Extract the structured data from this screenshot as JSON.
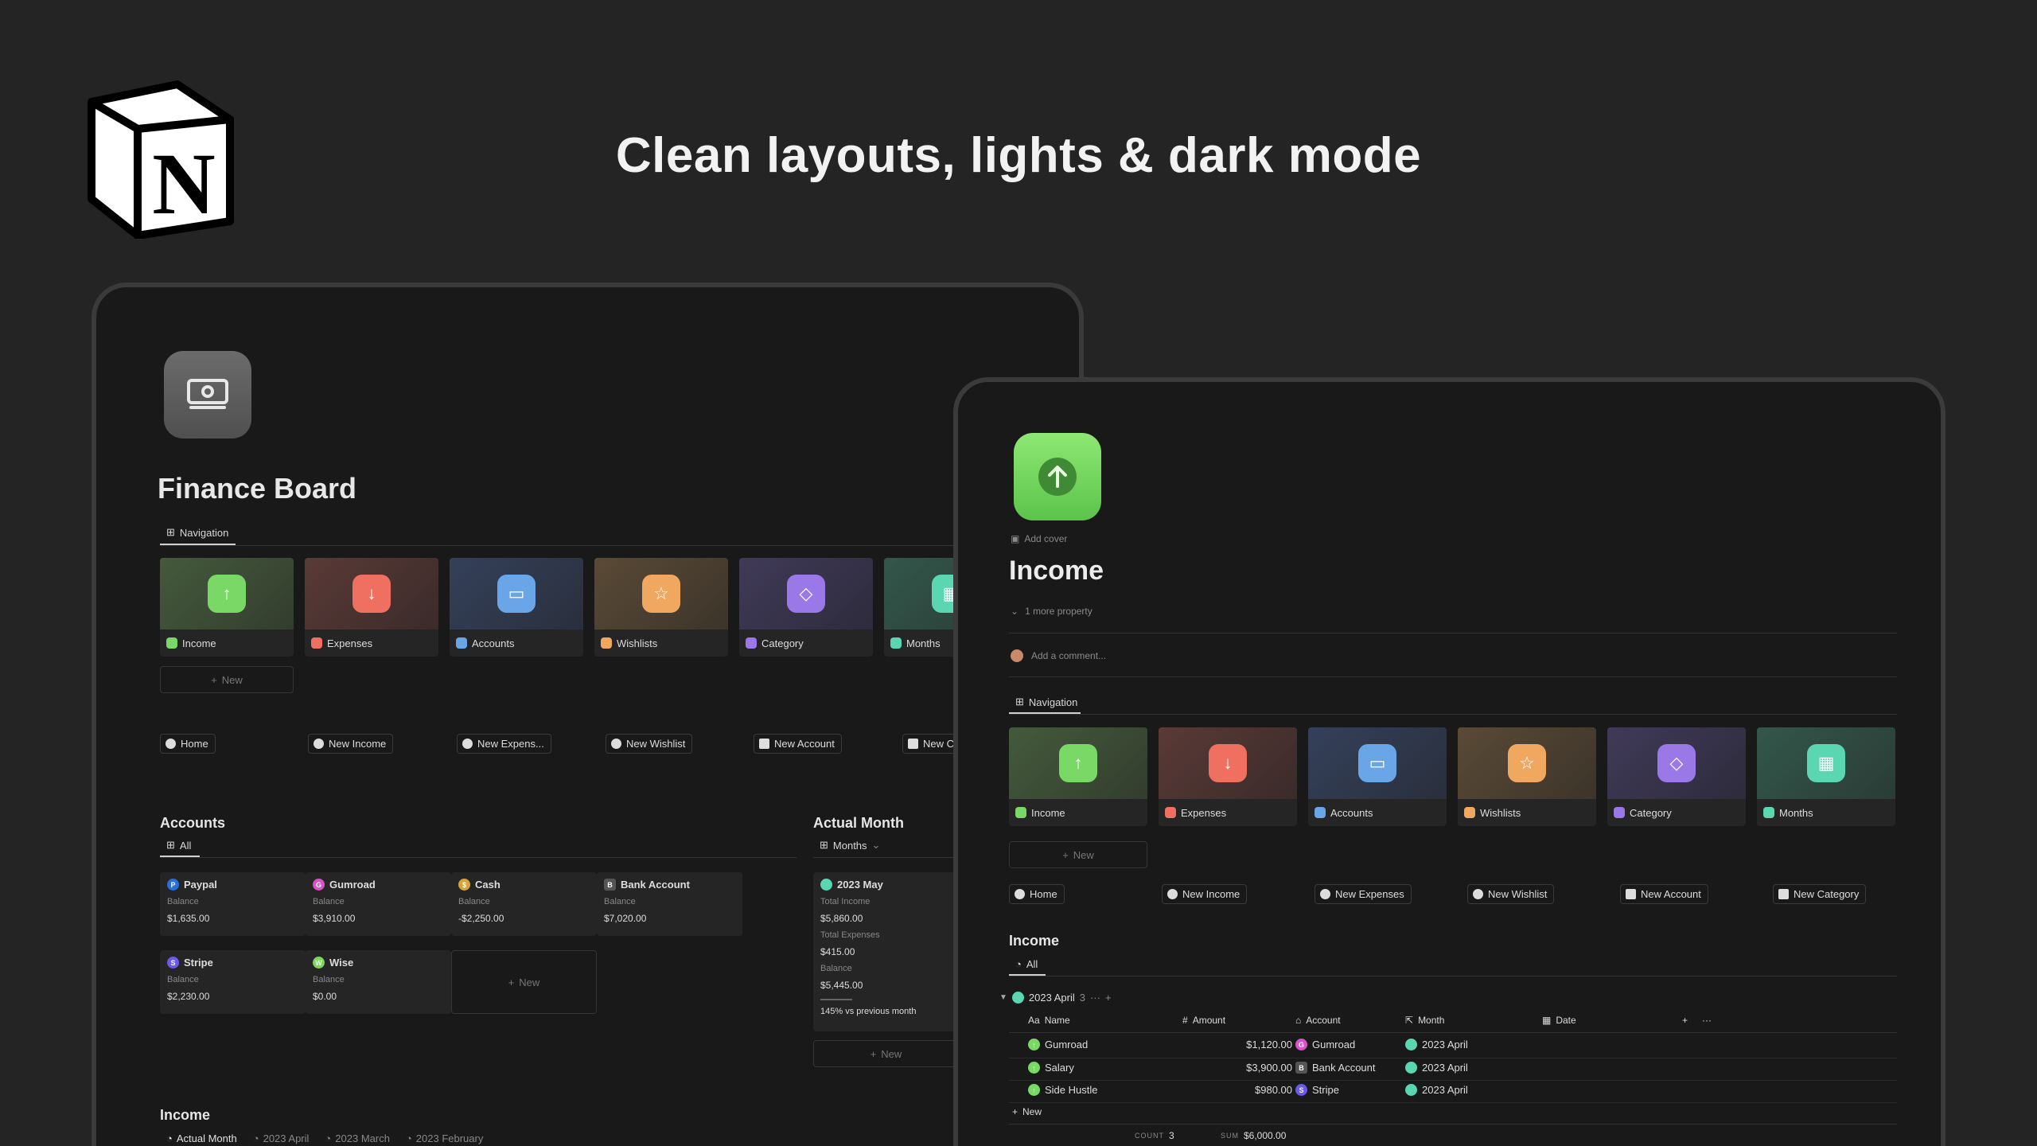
{
  "headline": "Clean layouts, lights & dark mode",
  "colors": {
    "background": "#242424",
    "device_bg": "#191919",
    "income_green": "#6fd75a"
  },
  "finance_board": {
    "title": "Finance Board",
    "nav_tab": "Navigation",
    "nav_cards": [
      {
        "label": "Income",
        "icon": "arrow-up-icon",
        "cover": "#3c4a35",
        "tile": "#79d866"
      },
      {
        "label": "Expenses",
        "icon": "arrow-down-icon",
        "cover": "#4d3633",
        "tile": "#ef7060"
      },
      {
        "label": "Accounts",
        "icon": "card-icon",
        "cover": "#32394a",
        "tile": "#6aa5e8"
      },
      {
        "label": "Wishlists",
        "icon": "star-icon",
        "cover": "#4e4232",
        "tile": "#f0a860"
      },
      {
        "label": "Category",
        "icon": "tag-icon",
        "cover": "#3a3548",
        "tile": "#9b78e8"
      },
      {
        "label": "Months",
        "icon": "calendar-icon",
        "cover": "#2f4a42",
        "tile": "#5ad6b0"
      }
    ],
    "new_label": "New",
    "quick_buttons": [
      "Home",
      "New Income",
      "New Expens...",
      "New Wishlist",
      "New Account",
      "New C"
    ],
    "accounts_title": "Accounts",
    "accounts_tab": "All",
    "balance_label": "Balance",
    "accounts": [
      {
        "name": "Paypal",
        "balance": "$1,635.00",
        "badge": "P",
        "color": "#2a6fd6"
      },
      {
        "name": "Gumroad",
        "balance": "$3,910.00",
        "badge": "G",
        "color": "#d653c8"
      },
      {
        "name": "Cash",
        "balance": "-$2,250.00",
        "badge": "$",
        "color": "#d6a43a"
      },
      {
        "name": "Bank Account",
        "balance": "$7,020.00",
        "badge": "B",
        "color": "#555555"
      },
      {
        "name": "Stripe",
        "balance": "$2,230.00",
        "badge": "S",
        "color": "#6a5ae8"
      },
      {
        "name": "Wise",
        "balance": "$0.00",
        "badge": "W",
        "color": "#7cd65a"
      }
    ],
    "actual_month_title": "Actual Month",
    "actual_month_tab": "Months",
    "month_card": {
      "name": "2023 May",
      "total_income_label": "Total Income",
      "total_income": "$5,860.00",
      "total_expenses_label": "Total Expenses",
      "total_expenses": "$415.00",
      "balance_label": "Balance",
      "balance": "$5,445.00",
      "ratio": "145% vs previous month"
    },
    "income_title": "Income",
    "income_tabs": [
      "Actual Month",
      "2023 April",
      "2023 March",
      "2023 February"
    ]
  },
  "income_page": {
    "add_cover": "Add cover",
    "title": "Income",
    "more_property": "1 more property",
    "add_comment": "Add a comment...",
    "nav_tab": "Navigation",
    "nav_cards": [
      "Income",
      "Expenses",
      "Accounts",
      "Wishlists",
      "Category",
      "Months"
    ],
    "new_label": "New",
    "quick_buttons": [
      "Home",
      "New Income",
      "New Expenses",
      "New Wishlist",
      "New Account",
      "New Category"
    ],
    "section_title": "Income",
    "view_tab": "All",
    "group_name": "2023 April",
    "group_count": "3",
    "columns": {
      "name": "Name",
      "amount": "Amount",
      "account": "Account",
      "month": "Month",
      "date": "Date"
    },
    "column_prefix": {
      "name": "Aa",
      "amount": "#"
    },
    "rows": [
      {
        "name": "Gumroad",
        "amount": "$1,120.00",
        "account": "Gumroad",
        "acct_badge": "G",
        "acct_color": "#d653c8",
        "month": "2023 April"
      },
      {
        "name": "Salary",
        "amount": "$3,900.00",
        "account": "Bank Account",
        "acct_badge": "B",
        "acct_color": "#555555",
        "month": "2023 April"
      },
      {
        "name": "Side Hustle",
        "amount": "$980.00",
        "account": "Stripe",
        "acct_badge": "S",
        "acct_color": "#6a5ae8",
        "month": "2023 April"
      }
    ],
    "count_label": "COUNT",
    "count_value": "3",
    "sum_label": "SUM",
    "sum_value": "$6,000.00"
  }
}
